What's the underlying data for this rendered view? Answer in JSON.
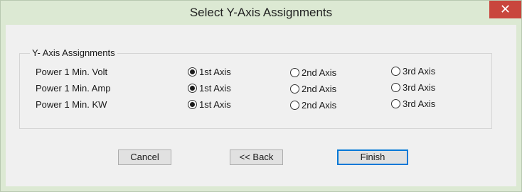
{
  "window": {
    "title": "Select Y-Axis Assignments",
    "close_glyph": "✕",
    "close_icon": "close-icon"
  },
  "group": {
    "label": "Y- Axis Assignments",
    "rows": [
      {
        "label": "Power 1 Min. Volt",
        "selected": "1st Axis"
      },
      {
        "label": "Power 1 Min. Amp",
        "selected": "1st Axis"
      },
      {
        "label": "Power 1 Min. KW",
        "selected": "1st Axis"
      }
    ],
    "options": [
      "1st Axis",
      "2nd Axis",
      "3rd Axis"
    ]
  },
  "buttons": {
    "cancel": "Cancel",
    "back": "<< Back",
    "finish": "Finish"
  },
  "colors": {
    "titlebar": "#dce9d3",
    "close": "#c9463d",
    "default_button_border": "#0078d7"
  }
}
